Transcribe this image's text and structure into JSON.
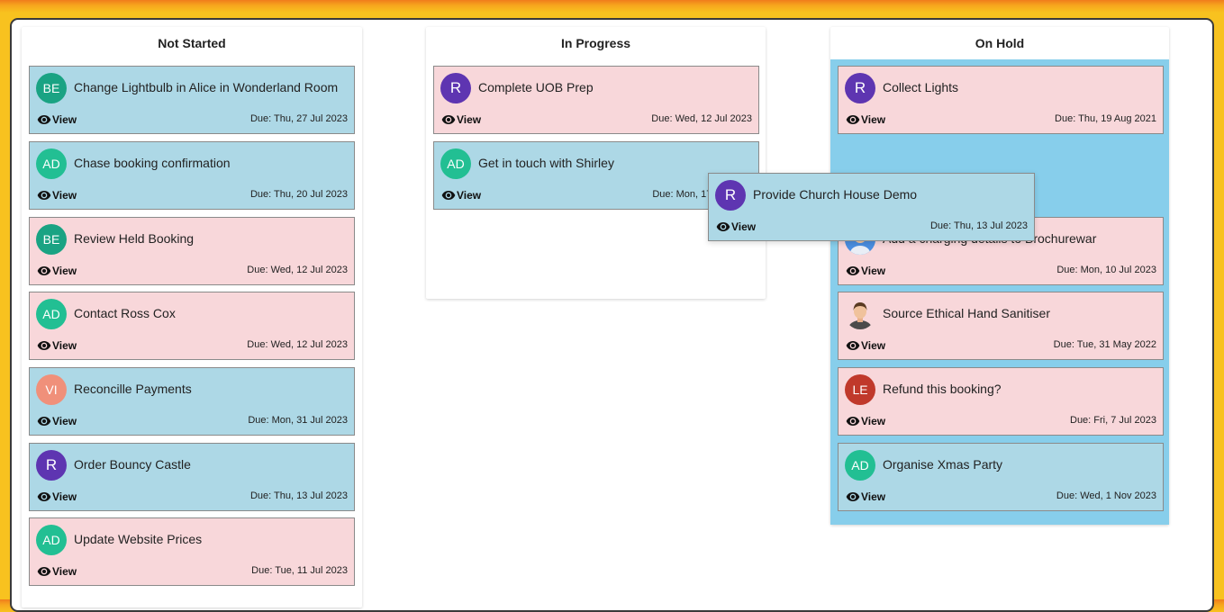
{
  "columns": [
    {
      "title": "Not Started",
      "cards": [
        {
          "initials": "BE",
          "title": "Change Lightbulb in Alice in Wonderland Room",
          "view": "View",
          "due": "Due: Thu, 27 Jul 2023"
        },
        {
          "initials": "AD",
          "title": "Chase booking confirmation",
          "view": "View",
          "due": "Due: Thu, 20 Jul 2023"
        },
        {
          "initials": "BE",
          "title": "Review Held Booking",
          "view": "View",
          "due": "Due: Wed, 12 Jul 2023"
        },
        {
          "initials": "AD",
          "title": "Contact Ross Cox",
          "view": "View",
          "due": "Due: Wed, 12 Jul 2023"
        },
        {
          "initials": "VI",
          "title": "Reconcille Payments",
          "view": "View",
          "due": "Due: Mon, 31 Jul 2023"
        },
        {
          "initials": "R",
          "title": "Order Bouncy Castle",
          "view": "View",
          "due": "Due: Thu, 13 Jul 2023"
        },
        {
          "initials": "AD",
          "title": "Update Website Prices",
          "view": "View",
          "due": "Due: Tue, 11 Jul 2023"
        }
      ]
    },
    {
      "title": "In Progress",
      "cards": [
        {
          "initials": "R",
          "title": "Complete UOB Prep",
          "view": "View",
          "due": "Due: Wed, 12 Jul 2023"
        },
        {
          "initials": "AD",
          "title": "Get in touch with Shirley",
          "view": "View",
          "due": "Due: Mon, 17 Jul 2023"
        }
      ]
    },
    {
      "title": "On Hold",
      "cards": [
        {
          "initials": "R",
          "title": "Collect Lights",
          "view": "View",
          "due": "Due: Thu, 19 Aug 2021"
        },
        {
          "initials": "",
          "title": "Add a charging details to Brochurewar",
          "view": "View",
          "due": "Due: Mon, 10 Jul 2023"
        },
        {
          "initials": "",
          "title": "Source Ethical Hand Sanitiser",
          "view": "View",
          "due": "Due: Tue, 31 May 2022"
        },
        {
          "initials": "LE",
          "title": "Refund this booking?",
          "view": "View",
          "due": "Due: Fri, 7 Jul 2023"
        },
        {
          "initials": "AD",
          "title": "Organise Xmas Party",
          "view": "View",
          "due": "Due: Wed, 1 Nov 2023"
        }
      ]
    }
  ],
  "dragging_card": {
    "initials": "R",
    "title": "Provide Church House Demo",
    "view": "View",
    "due": "Due: Thu, 13 Jul 2023"
  },
  "colors": {
    "card_blue": "#add8e6",
    "card_pink": "#f8d7da",
    "on_hold_drop_zone": "#87ceeb",
    "frame_orange": "#f8c21f"
  },
  "icons": {
    "view": "eye-icon"
  }
}
